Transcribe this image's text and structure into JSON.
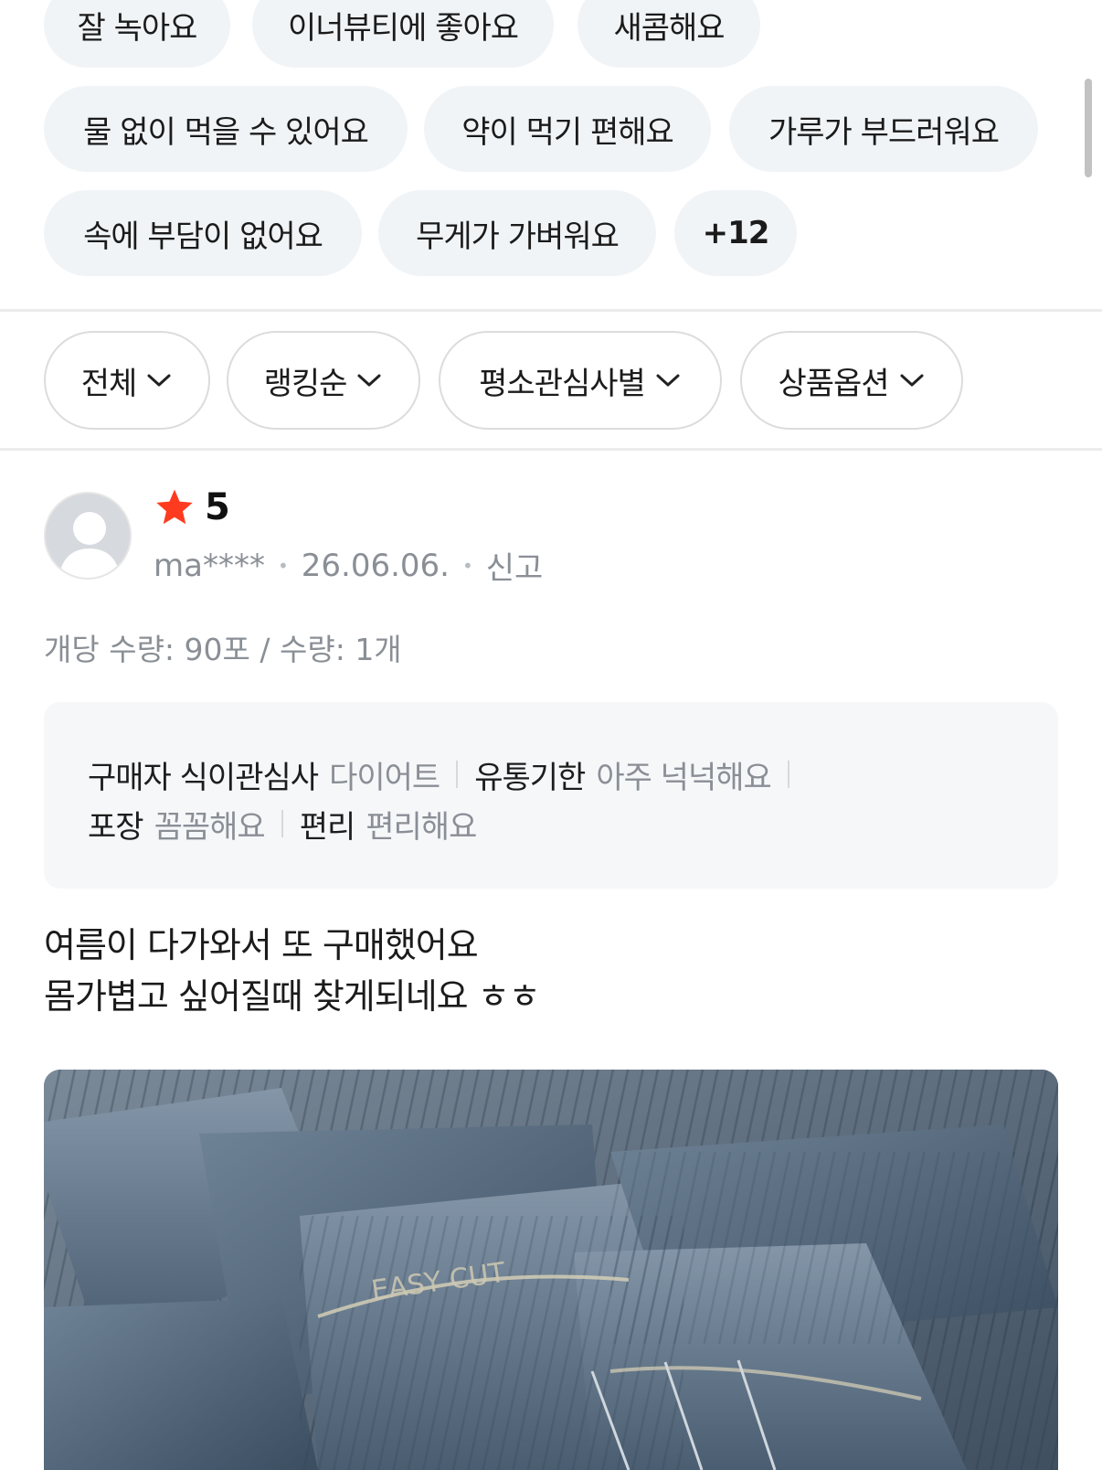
{
  "keyword_chips": {
    "row1": [
      "잘 녹아요",
      "이너뷰티에 좋아요",
      "새콤해요"
    ],
    "row2": [
      "물 없이 먹을 수 있어요",
      "약이 먹기 편해요",
      "가루가 부드러워요"
    ],
    "row3": [
      "속에 부담이 없어요",
      "무게가 가벼워요"
    ],
    "more_label": "+12"
  },
  "filters": [
    {
      "label": "전체"
    },
    {
      "label": "랭킹순"
    },
    {
      "label": "평소관심사별"
    },
    {
      "label": "상품옵션"
    }
  ],
  "review": {
    "rating": "5",
    "user": "ma****",
    "date": "26.06.06.",
    "report_label": "신고",
    "option_text": "개당 수량: 90포 / 수량: 1개",
    "attributes_line1": [
      {
        "key": "구매자 식이관심사",
        "value": "다이어트"
      },
      {
        "key": "유통기한",
        "value": "아주 넉넉해요"
      }
    ],
    "attributes_line2": [
      {
        "key": "포장",
        "value": "꼼꼼해요"
      },
      {
        "key": "편리",
        "value": "편리해요"
      }
    ],
    "body_line1": "여름이 다가와서 또 구매했어요",
    "body_line2": "몸가볍고 싶어질때 찾게되네요 ㅎㅎ",
    "photo_text": "EASY CUT"
  },
  "colors": {
    "chip_bg": "#f1f4f7",
    "star": "#ff3b1f",
    "muted_text": "#8a8f96",
    "photo_sachet": "#4f6276"
  },
  "icons": {
    "filter_caret": "chevron-down-icon",
    "rating_star": "star-icon",
    "avatar": "user-silhouette-icon"
  }
}
